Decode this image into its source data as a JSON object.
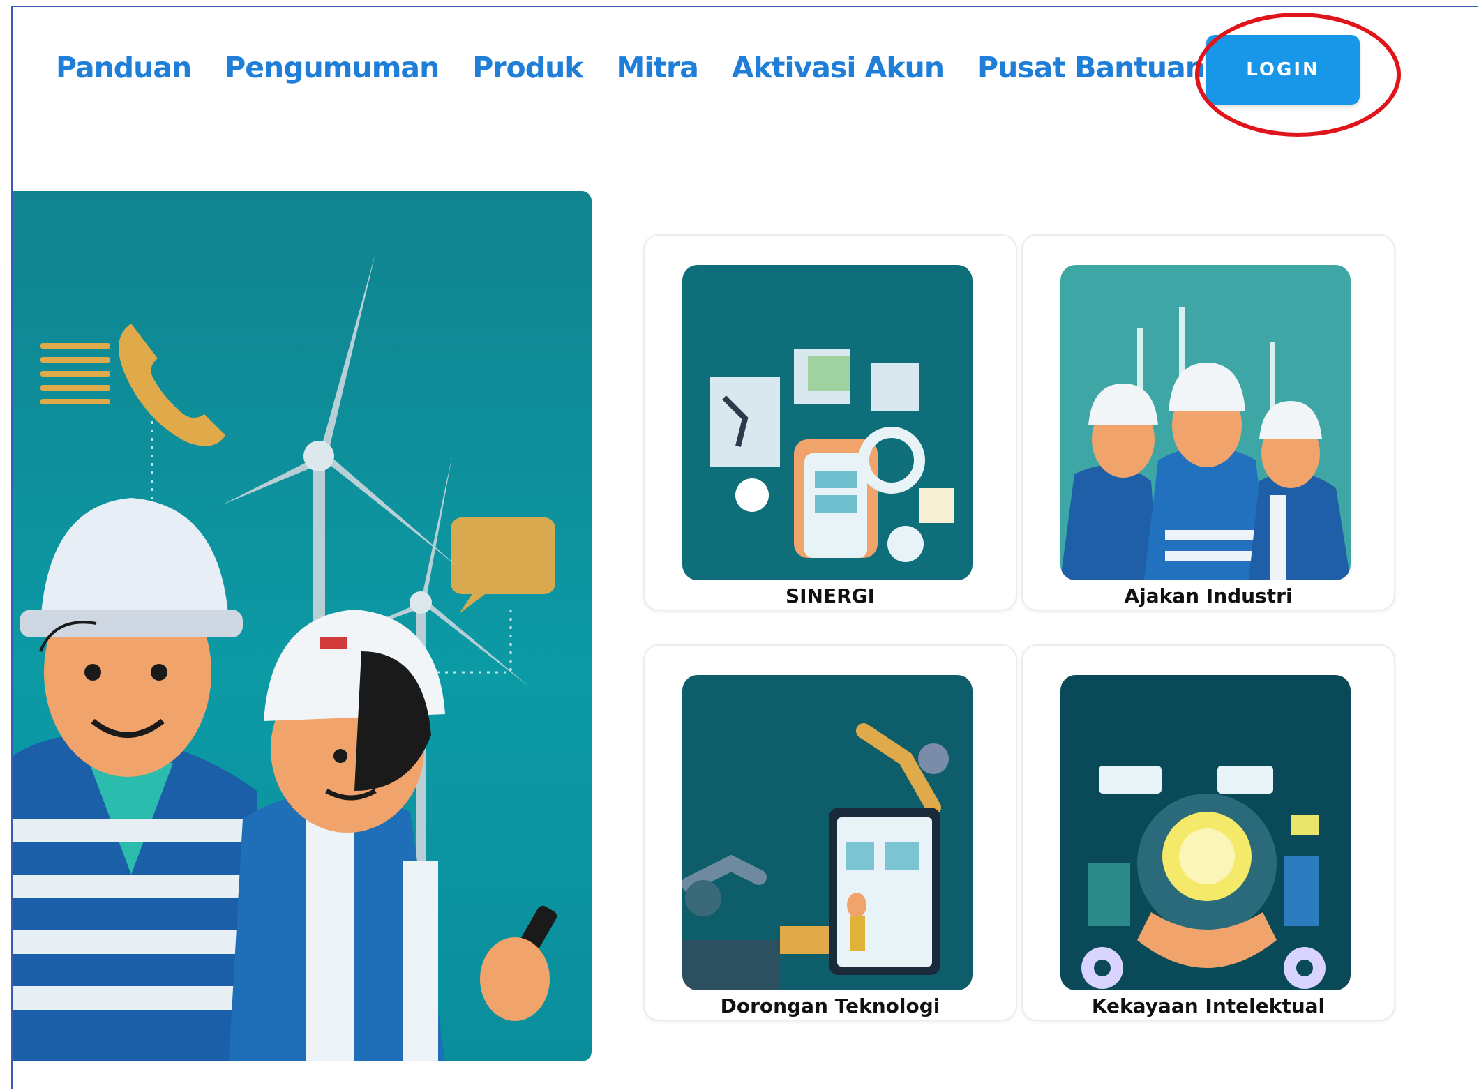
{
  "nav": {
    "items": [
      {
        "label": "Panduan"
      },
      {
        "label": "Pengumuman"
      },
      {
        "label": "Produk"
      },
      {
        "label": "Mitra"
      },
      {
        "label": "Aktivasi Akun"
      },
      {
        "label": "Pusat Bantuan"
      }
    ],
    "login_label": "LOGIN"
  },
  "cards": [
    {
      "label": "SINERGI"
    },
    {
      "label": "Ajakan Industri"
    },
    {
      "label": "Dorongan Teknologi"
    },
    {
      "label": "Kekayaan Intelektual"
    }
  ],
  "colors": {
    "nav_link": "#1f7fd8",
    "login_button": "#1896e8",
    "highlight_ring": "#e0141b",
    "hero_bg": "#0c9aa5"
  },
  "icons": [
    "phone-icon",
    "chat-bubble-icon",
    "wind-turbine-icon",
    "worker-illustration"
  ]
}
